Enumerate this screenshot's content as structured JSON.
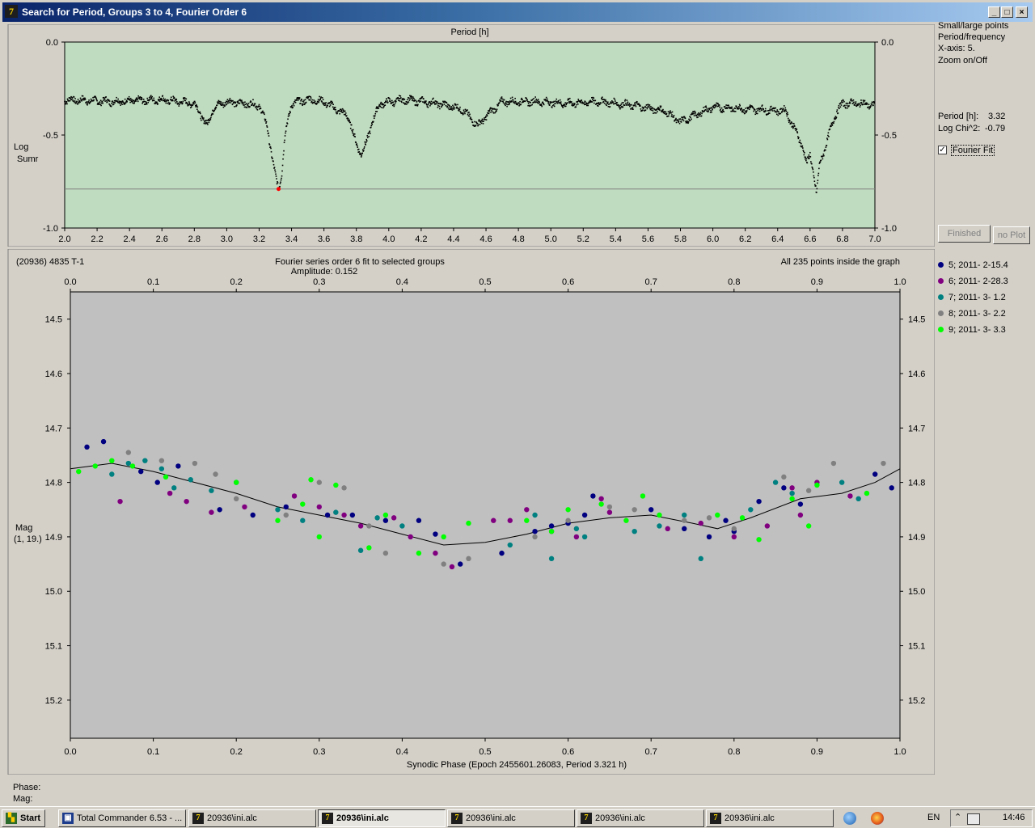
{
  "window": {
    "title": "Search for Period, Groups 3 to 4, Fourier Order 6",
    "app_icon": "7-app-icon",
    "controls": [
      "_",
      "□",
      "×"
    ]
  },
  "sidebar": {
    "options": [
      "Small/large points",
      "Period/frequency",
      "X-axis: 5.",
      "Zoom on/Off"
    ],
    "period_label": "Period [h]:",
    "period_value": "3.32",
    "chi_label": "Log Chi^2:",
    "chi_value": "-0.79",
    "fourier_fit_label": "Fourier Fit",
    "fourier_fit_checked": true,
    "finished_button": "Finished",
    "noplot_button": "no Plot"
  },
  "legend": [
    {
      "label": "5; 2011- 2-15.4",
      "color": "#000080"
    },
    {
      "label": "6; 2011- 2-28.3",
      "color": "#800080"
    },
    {
      "label": "7; 2011- 3- 1.2",
      "color": "#008080"
    },
    {
      "label": "8; 2011- 3- 2.2",
      "color": "#808080"
    },
    {
      "label": "9; 2011- 3- 3.3",
      "color": "#00ff00"
    }
  ],
  "bottom_readout": {
    "phase_label": "Phase:",
    "mag_label": "Mag:"
  },
  "taskbar": {
    "start": "Start",
    "items": [
      {
        "label": "Total Commander 6.53 - ...",
        "active": false
      },
      {
        "label": "20936\\ini.alc",
        "active": false
      },
      {
        "label": "20936\\ini.alc",
        "active": true
      },
      {
        "label": "20936\\ini.alc",
        "active": false
      },
      {
        "label": "20936\\ini.alc",
        "active": false
      },
      {
        "label": "20936\\ini.alc",
        "active": false
      }
    ],
    "lang": "EN",
    "clock": "14:46"
  },
  "chart_data": [
    {
      "type": "scatter",
      "title": "Period [h]",
      "ylabel": "Log Sumr",
      "xlim": [
        2.0,
        7.0
      ],
      "ylim": [
        -1.0,
        0.0
      ],
      "xticks": [
        2.0,
        2.2,
        2.4,
        2.6,
        2.8,
        3.0,
        3.2,
        3.4,
        3.6,
        3.8,
        4.0,
        4.2,
        4.4,
        4.6,
        4.8,
        5.0,
        5.2,
        5.4,
        5.6,
        5.8,
        6.0,
        6.2,
        6.4,
        6.6,
        6.8,
        7.0
      ],
      "yticks": [
        0.0,
        -0.5,
        -1.0
      ],
      "background": "#c0dcc0",
      "marker_color": "#000000",
      "best_period": {
        "x": 3.32,
        "y": -0.79,
        "color": "#ff0000"
      },
      "reference_line_y": -0.79,
      "baseline": [
        [
          2.0,
          -0.31
        ],
        [
          2.3,
          -0.32
        ],
        [
          2.6,
          -0.31
        ],
        [
          2.8,
          -0.33
        ],
        [
          2.88,
          -0.45
        ],
        [
          2.92,
          -0.35
        ],
        [
          3.0,
          -0.32
        ],
        [
          3.1,
          -0.33
        ],
        [
          3.2,
          -0.34
        ],
        [
          3.25,
          -0.45
        ],
        [
          3.28,
          -0.62
        ],
        [
          3.3,
          -0.72
        ],
        [
          3.32,
          -0.79
        ],
        [
          3.34,
          -0.7
        ],
        [
          3.36,
          -0.5
        ],
        [
          3.4,
          -0.33
        ],
        [
          3.5,
          -0.31
        ],
        [
          3.6,
          -0.32
        ],
        [
          3.75,
          -0.4
        ],
        [
          3.8,
          -0.55
        ],
        [
          3.83,
          -0.6
        ],
        [
          3.86,
          -0.55
        ],
        [
          3.9,
          -0.42
        ],
        [
          3.95,
          -0.33
        ],
        [
          4.1,
          -0.31
        ],
        [
          4.3,
          -0.33
        ],
        [
          4.45,
          -0.36
        ],
        [
          4.55,
          -0.45
        ],
        [
          4.6,
          -0.4
        ],
        [
          4.7,
          -0.32
        ],
        [
          4.9,
          -0.32
        ],
        [
          5.1,
          -0.33
        ],
        [
          5.3,
          -0.32
        ],
        [
          5.5,
          -0.34
        ],
        [
          5.7,
          -0.37
        ],
        [
          5.8,
          -0.43
        ],
        [
          5.9,
          -0.39
        ],
        [
          6.0,
          -0.35
        ],
        [
          6.2,
          -0.36
        ],
        [
          6.45,
          -0.37
        ],
        [
          6.55,
          -0.55
        ],
        [
          6.58,
          -0.66
        ],
        [
          6.6,
          -0.6
        ],
        [
          6.62,
          -0.7
        ],
        [
          6.64,
          -0.82
        ],
        [
          6.66,
          -0.65
        ],
        [
          6.7,
          -0.55
        ],
        [
          6.75,
          -0.4
        ],
        [
          6.8,
          -0.33
        ],
        [
          6.9,
          -0.33
        ],
        [
          7.0,
          -0.34
        ]
      ]
    },
    {
      "type": "scatter",
      "title": "Fourier series order 6 fit to selected groups",
      "subtitle": "Amplitude: 0.152",
      "object_label": "(20936) 4835 T-1",
      "points_note": "All 235 points inside the graph",
      "xlabel": "Synodic Phase (Epoch 2455601.26083, Period 3.321 h)",
      "ylabel": "Mag",
      "ylabel2": "(1, 19.)",
      "xlim": [
        0.0,
        1.0
      ],
      "ylim": [
        14.45,
        15.27
      ],
      "y_inverted": true,
      "xticks": [
        0.0,
        0.1,
        0.2,
        0.3,
        0.4,
        0.5,
        0.6,
        0.7,
        0.8,
        0.9,
        1.0
      ],
      "yticks": [
        14.5,
        14.6,
        14.7,
        14.8,
        14.9,
        15.0,
        15.1,
        15.2
      ],
      "background": "#c0c0c0",
      "fit_curve": [
        [
          0.0,
          14.775
        ],
        [
          0.05,
          14.765
        ],
        [
          0.1,
          14.78
        ],
        [
          0.15,
          14.8
        ],
        [
          0.2,
          14.82
        ],
        [
          0.25,
          14.845
        ],
        [
          0.3,
          14.86
        ],
        [
          0.35,
          14.875
        ],
        [
          0.4,
          14.895
        ],
        [
          0.45,
          14.915
        ],
        [
          0.5,
          14.91
        ],
        [
          0.55,
          14.895
        ],
        [
          0.6,
          14.875
        ],
        [
          0.65,
          14.865
        ],
        [
          0.7,
          14.86
        ],
        [
          0.75,
          14.875
        ],
        [
          0.78,
          14.885
        ],
        [
          0.82,
          14.865
        ],
        [
          0.88,
          14.83
        ],
        [
          0.93,
          14.82
        ],
        [
          0.97,
          14.8
        ],
        [
          1.0,
          14.775
        ]
      ],
      "series": [
        {
          "name": "5; 2011- 2-15.4",
          "color": "#000080",
          "points": [
            [
              0.02,
              14.735
            ],
            [
              0.04,
              14.725
            ],
            [
              0.085,
              14.78
            ],
            [
              0.105,
              14.8
            ],
            [
              0.13,
              14.77
            ],
            [
              0.18,
              14.85
            ],
            [
              0.22,
              14.86
            ],
            [
              0.26,
              14.845
            ],
            [
              0.31,
              14.86
            ],
            [
              0.34,
              14.86
            ],
            [
              0.38,
              14.87
            ],
            [
              0.42,
              14.87
            ],
            [
              0.44,
              14.895
            ],
            [
              0.47,
              14.95
            ],
            [
              0.52,
              14.93
            ],
            [
              0.56,
              14.89
            ],
            [
              0.58,
              14.88
            ],
            [
              0.6,
              14.875
            ],
            [
              0.62,
              14.86
            ],
            [
              0.63,
              14.825
            ],
            [
              0.7,
              14.85
            ],
            [
              0.74,
              14.885
            ],
            [
              0.77,
              14.9
            ],
            [
              0.79,
              14.87
            ],
            [
              0.8,
              14.89
            ],
            [
              0.83,
              14.835
            ],
            [
              0.86,
              14.81
            ],
            [
              0.88,
              14.84
            ],
            [
              0.97,
              14.785
            ],
            [
              0.99,
              14.81
            ]
          ]
        },
        {
          "name": "6; 2011- 2-28.3",
          "color": "#800080",
          "points": [
            [
              0.06,
              14.835
            ],
            [
              0.12,
              14.82
            ],
            [
              0.14,
              14.835
            ],
            [
              0.17,
              14.855
            ],
            [
              0.21,
              14.845
            ],
            [
              0.27,
              14.825
            ],
            [
              0.3,
              14.845
            ],
            [
              0.33,
              14.86
            ],
            [
              0.35,
              14.88
            ],
            [
              0.39,
              14.865
            ],
            [
              0.41,
              14.9
            ],
            [
              0.44,
              14.93
            ],
            [
              0.46,
              14.955
            ],
            [
              0.51,
              14.87
            ],
            [
              0.53,
              14.87
            ],
            [
              0.55,
              14.85
            ],
            [
              0.58,
              14.89
            ],
            [
              0.61,
              14.9
            ],
            [
              0.64,
              14.83
            ],
            [
              0.65,
              14.855
            ],
            [
              0.72,
              14.885
            ],
            [
              0.76,
              14.875
            ],
            [
              0.8,
              14.9
            ],
            [
              0.84,
              14.88
            ],
            [
              0.87,
              14.81
            ],
            [
              0.88,
              14.86
            ],
            [
              0.9,
              14.8
            ],
            [
              0.94,
              14.825
            ]
          ]
        },
        {
          "name": "7; 2011- 3- 1.2",
          "color": "#008080",
          "points": [
            [
              0.05,
              14.785
            ],
            [
              0.07,
              14.765
            ],
            [
              0.09,
              14.76
            ],
            [
              0.11,
              14.775
            ],
            [
              0.125,
              14.81
            ],
            [
              0.145,
              14.795
            ],
            [
              0.17,
              14.815
            ],
            [
              0.2,
              14.8
            ],
            [
              0.25,
              14.85
            ],
            [
              0.28,
              14.87
            ],
            [
              0.32,
              14.855
            ],
            [
              0.35,
              14.925
            ],
            [
              0.37,
              14.865
            ],
            [
              0.4,
              14.88
            ],
            [
              0.53,
              14.915
            ],
            [
              0.56,
              14.86
            ],
            [
              0.58,
              14.94
            ],
            [
              0.61,
              14.885
            ],
            [
              0.62,
              14.9
            ],
            [
              0.68,
              14.89
            ],
            [
              0.71,
              14.88
            ],
            [
              0.74,
              14.86
            ],
            [
              0.76,
              14.94
            ],
            [
              0.82,
              14.85
            ],
            [
              0.85,
              14.8
            ],
            [
              0.87,
              14.82
            ],
            [
              0.93,
              14.8
            ],
            [
              0.95,
              14.83
            ]
          ]
        },
        {
          "name": "8; 2011- 3- 2.2",
          "color": "#808080",
          "points": [
            [
              0.07,
              14.745
            ],
            [
              0.11,
              14.76
            ],
            [
              0.15,
              14.765
            ],
            [
              0.175,
              14.785
            ],
            [
              0.2,
              14.83
            ],
            [
              0.26,
              14.86
            ],
            [
              0.3,
              14.8
            ],
            [
              0.33,
              14.81
            ],
            [
              0.36,
              14.88
            ],
            [
              0.38,
              14.93
            ],
            [
              0.45,
              14.95
            ],
            [
              0.48,
              14.94
            ],
            [
              0.56,
              14.9
            ],
            [
              0.6,
              14.87
            ],
            [
              0.65,
              14.845
            ],
            [
              0.68,
              14.85
            ],
            [
              0.74,
              14.87
            ],
            [
              0.77,
              14.865
            ],
            [
              0.8,
              14.885
            ],
            [
              0.86,
              14.79
            ],
            [
              0.89,
              14.815
            ],
            [
              0.92,
              14.765
            ],
            [
              0.98,
              14.765
            ]
          ]
        },
        {
          "name": "9; 2011- 3- 3.3",
          "color": "#00ff00",
          "points": [
            [
              0.01,
              14.78
            ],
            [
              0.03,
              14.77
            ],
            [
              0.05,
              14.76
            ],
            [
              0.075,
              14.77
            ],
            [
              0.115,
              14.79
            ],
            [
              0.2,
              14.8
            ],
            [
              0.25,
              14.87
            ],
            [
              0.28,
              14.84
            ],
            [
              0.29,
              14.795
            ],
            [
              0.3,
              14.9
            ],
            [
              0.32,
              14.805
            ],
            [
              0.36,
              14.92
            ],
            [
              0.38,
              14.86
            ],
            [
              0.42,
              14.93
            ],
            [
              0.45,
              14.9
            ],
            [
              0.48,
              14.875
            ],
            [
              0.55,
              14.87
            ],
            [
              0.58,
              14.89
            ],
            [
              0.6,
              14.85
            ],
            [
              0.64,
              14.84
            ],
            [
              0.67,
              14.87
            ],
            [
              0.69,
              14.825
            ],
            [
              0.71,
              14.86
            ],
            [
              0.78,
              14.86
            ],
            [
              0.81,
              14.865
            ],
            [
              0.83,
              14.905
            ],
            [
              0.87,
              14.83
            ],
            [
              0.89,
              14.88
            ],
            [
              0.9,
              14.805
            ],
            [
              0.96,
              14.82
            ]
          ]
        }
      ]
    }
  ]
}
